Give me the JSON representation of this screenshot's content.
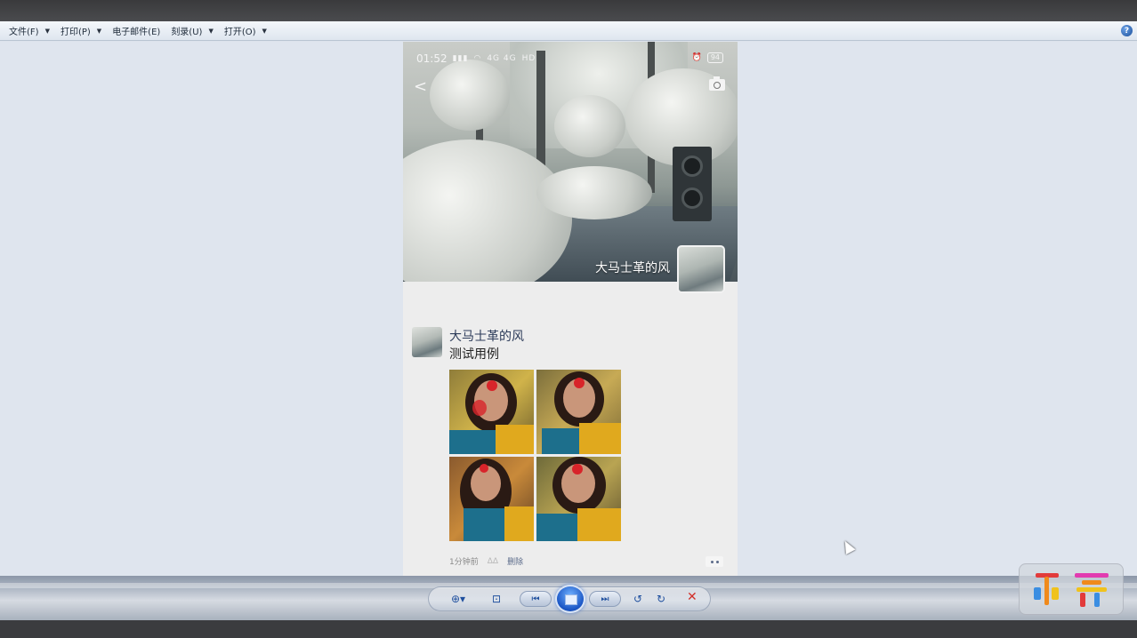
{
  "menubar": {
    "items": [
      {
        "label": "文件(F)",
        "has_arrow": true
      },
      {
        "label": "打印(P)",
        "has_arrow": true
      },
      {
        "label": "电子邮件(E)",
        "has_arrow": false
      },
      {
        "label": "刻录(U)",
        "has_arrow": true
      },
      {
        "label": "打开(O)",
        "has_arrow": true
      }
    ],
    "help_icon": "?"
  },
  "phone": {
    "status": {
      "time": "01:52",
      "network": "4G 4G",
      "hd": "HD",
      "battery": "94"
    },
    "cover": {
      "name": "大马士革的风"
    },
    "post": {
      "author": "大马士革的风",
      "text": "测试用例",
      "photo_count": 4,
      "time_ago": "1分钟前",
      "faint_icon": "ΔΔ",
      "delete_label": "删除"
    }
  },
  "controls": {
    "zoom_icon": "magnifier-icon",
    "fit_icon": "fit-to-window-icon",
    "prev_icon": "previous-icon",
    "slideshow_icon": "slideshow-icon",
    "next_icon": "next-icon",
    "rotate_left_icon": "rotate-ccw-icon",
    "rotate_right_icon": "rotate-cw-icon",
    "delete_icon": "delete-x-icon",
    "accent": "#1a55c4",
    "delete_color": "#d2302a"
  }
}
